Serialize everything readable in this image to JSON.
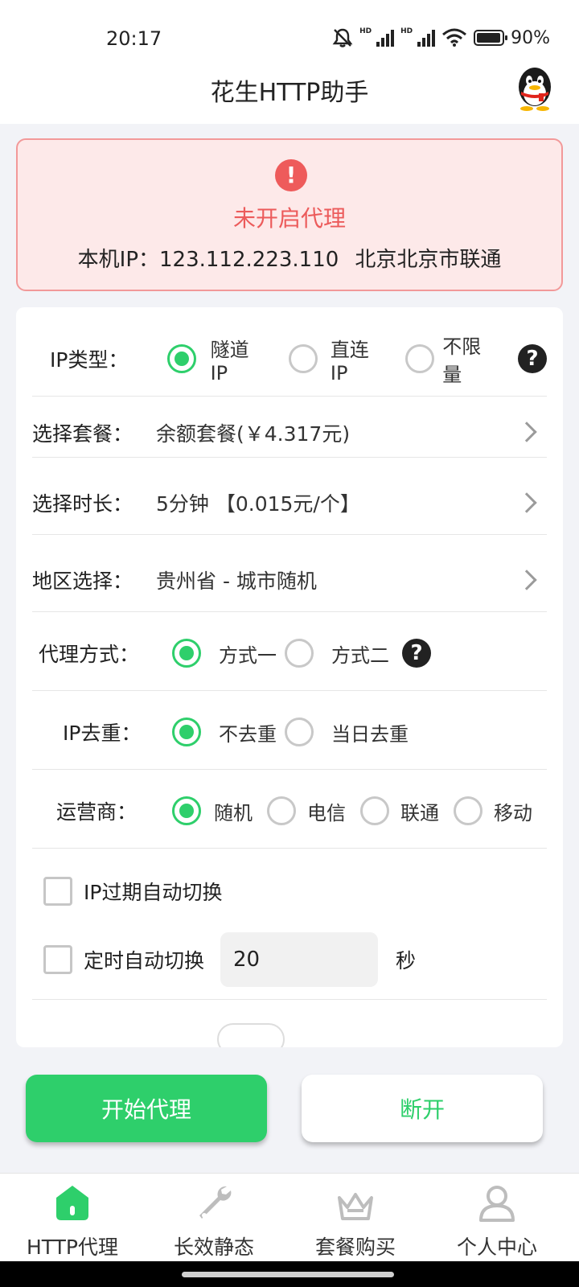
{
  "status_bar": {
    "time": "20:17",
    "hd_label": "HD",
    "battery": "90%",
    "icons": [
      "mute-icon",
      "signal-icon",
      "signal-icon",
      "wifi-icon",
      "battery-icon"
    ]
  },
  "app": {
    "title": "花生HTTP助手",
    "avatar_icon": "qq-penguin-icon"
  },
  "alert": {
    "icon": "!",
    "status": "未开启代理",
    "ip_label": "本机IP：123.112.223.110",
    "location": "北京北京市联通",
    "colors": {
      "bg": "#fde9e9",
      "border": "#f29999",
      "text": "#ec5b5b"
    }
  },
  "form": {
    "ip_type": {
      "label": "IP类型：",
      "options": [
        "隧道IP",
        "直连IP",
        "不限量"
      ],
      "selected": 0
    },
    "package": {
      "label": "选择套餐：",
      "value": "余额套餐(￥4.317元)"
    },
    "duration": {
      "label": "选择时长：",
      "value": "5分钟 【0.015元/个】"
    },
    "region": {
      "label": "地区选择：",
      "value": "贵州省 - 城市随机"
    },
    "proxy_mode": {
      "label": "代理方式：",
      "options": [
        "方式一",
        "方式二"
      ],
      "selected": 0
    },
    "dedupe": {
      "label": "IP去重：",
      "options": [
        "不去重",
        "当日去重"
      ],
      "selected": 0
    },
    "carrier": {
      "label": "运营商：",
      "options": [
        "随机",
        "电信",
        "联通",
        "移动"
      ],
      "selected": 0
    },
    "auto_switch_expire": {
      "label": "IP过期自动切换",
      "checked": false
    },
    "auto_switch_timer": {
      "label": "定时自动切换",
      "checked": false,
      "value": "20",
      "unit": "秒"
    },
    "help_glyph": "?"
  },
  "actions": {
    "start_label": "开始代理",
    "stop_label": "断开",
    "accent": "#2ecf6b"
  },
  "tabs": [
    {
      "label": "HTTP代理",
      "icon": "home-icon",
      "active": true
    },
    {
      "label": "长效静态",
      "icon": "wrench-icon",
      "active": false
    },
    {
      "label": "套餐购买",
      "icon": "basket-icon",
      "active": false
    },
    {
      "label": "个人中心",
      "icon": "user-icon",
      "active": false
    }
  ]
}
